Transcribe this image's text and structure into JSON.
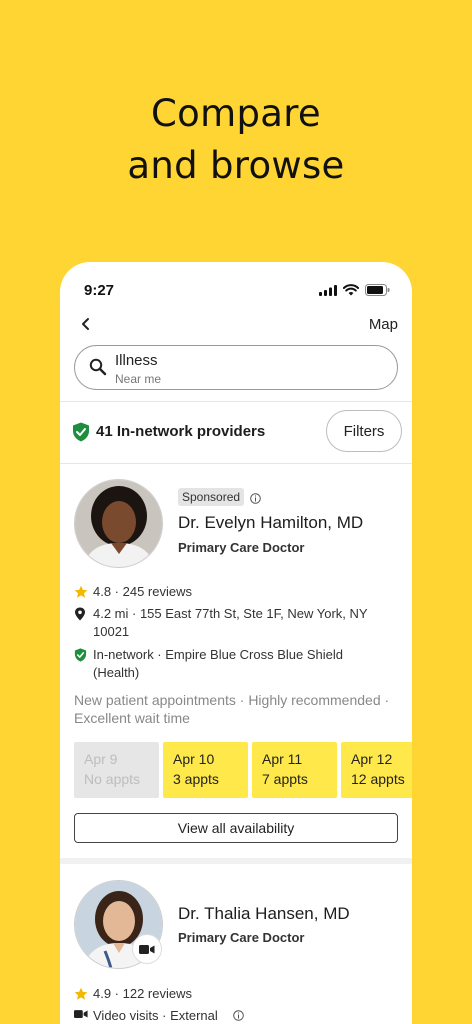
{
  "headline": {
    "line1": "Compare",
    "line2": "and browse"
  },
  "status": {
    "time": "9:27"
  },
  "nav": {
    "map": "Map"
  },
  "search": {
    "query": "Illness",
    "location": "Near me"
  },
  "results": {
    "count_label": "41 In-network providers",
    "filters_label": "Filters"
  },
  "providers": [
    {
      "badge": "Sponsored",
      "name": "Dr. Evelyn Hamilton, MD",
      "specialty": "Primary Care Doctor",
      "rating": "4.8 · 245 reviews",
      "address": "4.2 mi · 155 East 77th St, Ste 1F, New York, NY 10021",
      "network": "In-network · Empire Blue Cross Blue Shield (Health)",
      "notes": "New patient appointments · Highly recommended · Excellent wait time",
      "slots": [
        {
          "date": "Apr 9",
          "appts": "No appts",
          "available": false
        },
        {
          "date": "Apr 10",
          "appts": "3 appts",
          "available": true
        },
        {
          "date": "Apr 11",
          "appts": "7 appts",
          "available": true
        },
        {
          "date": "Apr 12",
          "appts": "12 appts",
          "available": true
        }
      ],
      "view_all": "View all availability"
    },
    {
      "name": "Dr. Thalia Hansen, MD",
      "specialty": "Primary Care Doctor",
      "rating": "4.9 · 122 reviews",
      "visit_type": "Video visits · External"
    }
  ],
  "colors": {
    "brand_yellow": "#FFD533",
    "slot_yellow": "#FFE94A",
    "star": "#F2B900",
    "shield_green": "#1E8E3E"
  }
}
